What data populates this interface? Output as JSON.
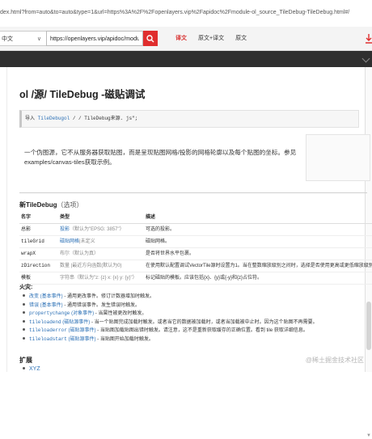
{
  "browser": {
    "address_text": "dex.html?from=auto&to=auto&type=1&url=https%3A%2F%2Fopenlayers.vip%2Fapidoc%2Fmodule-ol_source_TileDebug-TileDebug.html#/"
  },
  "translate_bar": {
    "language_select": "中文",
    "url_value": "https://openlayers.vip/apidoc/module",
    "tabs": [
      "译文",
      "原文+译文",
      "原文"
    ],
    "active_tab": "译文"
  },
  "page": {
    "title": "ol /源/ TileDebug -磁贴调试",
    "import_prefix": "导入",
    "import_name": "TileDebugol",
    "import_rest": " / / TileDebug来源. js\";",
    "description": "一个伪图源，它不从服务器获取贴图，而是呈现贴图网格/投影的网格轮廓以及每个贴图的坐标。参见examples/canvas-tiles获取示例。",
    "constructor_title": "新TileDebug",
    "constructor_opt": "（选项）",
    "table_headers": [
      "名字",
      "类型",
      "描述"
    ],
    "params": [
      {
        "name": "总影",
        "type": "投影",
        "default": "（默认为\"EPSG: 3857\"）",
        "desc": "可选的投影。"
      },
      {
        "name": "tileGrid",
        "type": "磁贴网格",
        "default": "|未定义",
        "desc": "磁贴网格。"
      },
      {
        "name": "wrapX",
        "type": "",
        "default": "布尔（默认为真）",
        "desc": "是否将世界水平包裹。"
      },
      {
        "name": "zDirection",
        "type": "",
        "default": "数量 |最近方向函数(默认为0)",
        "desc": "在使用默认配置调试VectorTile源时设置为1。当在整数缩放级别之间时，选择是否使用更高或更低缩放级别的贴图。"
      },
      {
        "name": "模板",
        "type": "",
        "default": "字符串（默认为\"z: {z} x: {x} y: {y}\"）",
        "desc": "标记磁贴的模板。应该包括{x}、{y}或{-y}和{z}占位符。"
      }
    ],
    "fires_title": "火灾:",
    "events": [
      {
        "code": "",
        "type": "改变 (基本事件)",
        "text": " - 通用更改事件。修订计数器增加时触发。"
      },
      {
        "code": "",
        "type": "错误 (基本事件)",
        "text": " - 通用错误事件。发生错误时触发。"
      },
      {
        "code": "propertychange",
        "type": " (对象事件)",
        "text": " - 当属性被更改时触发。"
      },
      {
        "code": "tileloadend",
        "type": " (磁贴源事件)",
        "text": " - 当一个贴图完成加载时触发。或者当它的数据被加载时，或者当加载被中止时。因为这个贴图不再需要。"
      },
      {
        "code": "tileloaderror",
        "type": " (磁贴源事件)",
        "text": " - 当贴图加载贴图出错时触发。请注意，这不是重新获取缓存的正确位置。看到 tile 获取详细信息。"
      },
      {
        "code": "tileloadstart",
        "type": " (磁贴源事件)",
        "text": " - 当贴图开始加载时触发。"
      }
    ],
    "extends_title": "扩展",
    "extends": [
      "XYZ"
    ]
  },
  "watermark": "@稀土掘金技术社区",
  "colors": {
    "accent_red": "#e02e2e",
    "link_blue": "#2a6fb5",
    "dark_band": "#2f2f2f"
  }
}
